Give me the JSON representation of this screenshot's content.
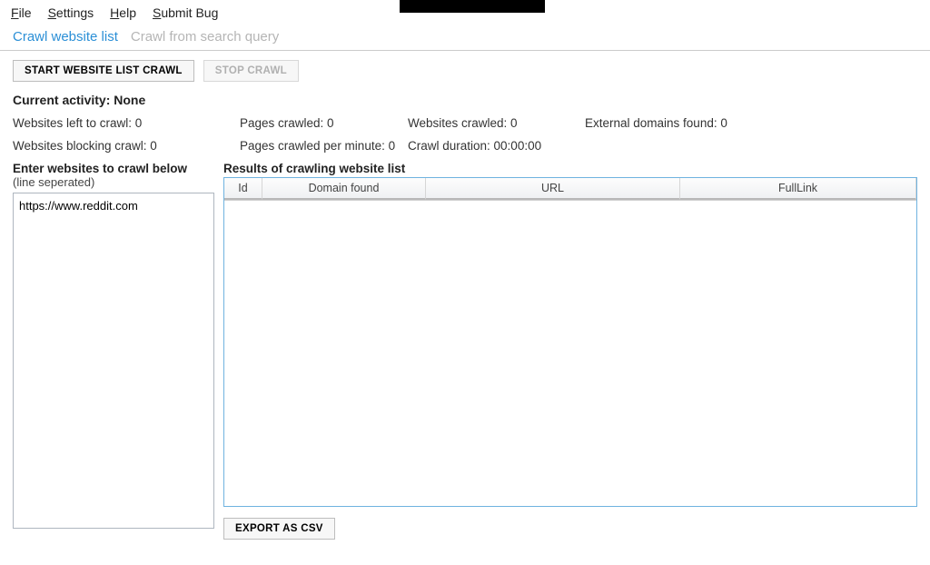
{
  "menubar": {
    "file": "File",
    "settings": "Settings",
    "help": "Help",
    "submit_bug": "Submit Bug"
  },
  "tabs": {
    "crawl_list": "Crawl website list",
    "crawl_search": "Crawl from search query"
  },
  "buttons": {
    "start": "START WEBSITE LIST CRAWL",
    "stop": "STOP CRAWL",
    "export": "EXPORT AS CSV"
  },
  "activity": {
    "label_prefix": "Current activity: ",
    "value": "None"
  },
  "stats": {
    "websites_left": "Websites left to crawl: 0",
    "pages_crawled": "Pages crawled: 0",
    "websites_crawled": "Websites crawled: 0",
    "external_domains": "External domains found: 0",
    "websites_blocking": "Websites blocking crawl: 0",
    "pages_per_minute": "Pages crawled per minute: 0",
    "crawl_duration": "Crawl duration: 00:00:00"
  },
  "left": {
    "heading": "Enter websites to crawl below",
    "subheading": "(line seperated)",
    "textarea_value": "https://www.reddit.com"
  },
  "right": {
    "heading": "Results of crawling website list"
  },
  "grid": {
    "columns": {
      "id": "Id",
      "domain": "Domain found",
      "url": "URL",
      "fulllink": "FullLink"
    },
    "rows": []
  }
}
